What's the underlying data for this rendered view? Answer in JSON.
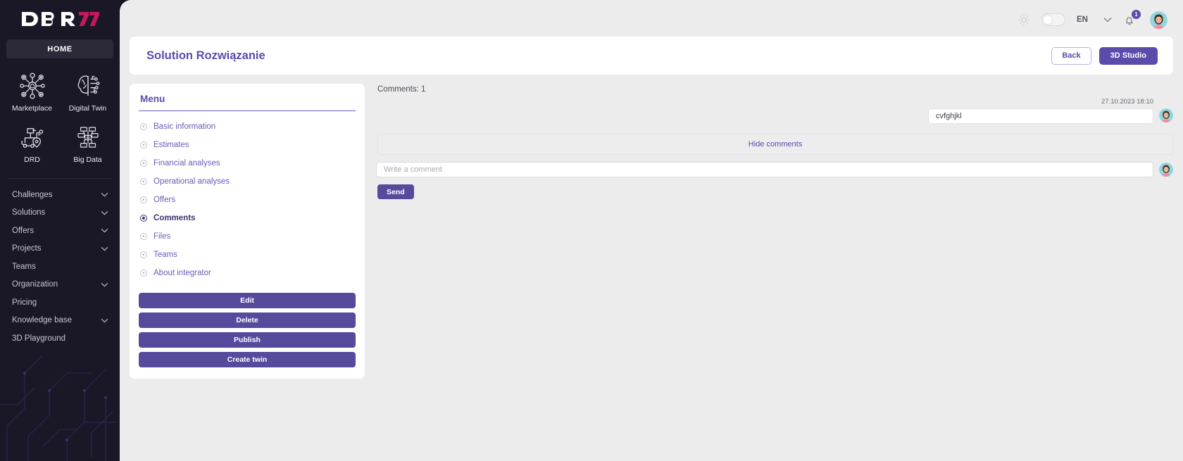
{
  "sidebar": {
    "logo_text": "DBR77",
    "home_label": "HOME",
    "quick": [
      {
        "label": "Marketplace",
        "icon": "marketplace-network-icon"
      },
      {
        "label": "Digital Twin",
        "icon": "digital-twin-brain-icon"
      },
      {
        "label": "DRD",
        "icon": "drd-map-icon"
      },
      {
        "label": "Big Data",
        "icon": "big-data-server-icon"
      }
    ],
    "nav": [
      {
        "label": "Challenges",
        "chevron": true
      },
      {
        "label": "Solutions",
        "chevron": true
      },
      {
        "label": "Offers",
        "chevron": true
      },
      {
        "label": "Projects",
        "chevron": true
      },
      {
        "label": "Teams",
        "chevron": false
      },
      {
        "label": "Organization",
        "chevron": true
      },
      {
        "label": "Pricing",
        "chevron": false
      },
      {
        "label": "Knowledge base",
        "chevron": true
      },
      {
        "label": "3D Playground",
        "chevron": false
      }
    ]
  },
  "topbar": {
    "sun_icon": "sun-icon",
    "theme_toggle": "theme-toggle",
    "language": "EN",
    "lang_chevron": "chevron-down-icon",
    "bell_icon": "bell-icon",
    "notification_count": "1",
    "avatar": "user-avatar"
  },
  "header": {
    "title": "Solution Rozwiązanie",
    "back_label": "Back",
    "studio_label": "3D Studio"
  },
  "menu": {
    "title": "Menu",
    "items": [
      {
        "label": "Basic information",
        "active": false
      },
      {
        "label": "Estimates",
        "active": false
      },
      {
        "label": "Financial analyses",
        "active": false
      },
      {
        "label": "Operational analyses",
        "active": false
      },
      {
        "label": "Offers",
        "active": false
      },
      {
        "label": "Comments",
        "active": true
      },
      {
        "label": "Files",
        "active": false
      },
      {
        "label": "Teams",
        "active": false
      },
      {
        "label": "About integrator",
        "active": false
      }
    ],
    "actions": [
      {
        "label": "Edit"
      },
      {
        "label": "Delete"
      },
      {
        "label": "Publish"
      },
      {
        "label": "Create twin"
      }
    ]
  },
  "comments": {
    "count_label": "Comments: 1",
    "items": [
      {
        "timestamp": "27.10.2023 18:10",
        "text": "cvfghjkl"
      }
    ],
    "hide_label": "Hide comments",
    "input_placeholder": "Write a comment",
    "input_value": "",
    "send_label": "Send"
  },
  "colors": {
    "accent": "#5b4bab",
    "button": "#564a9c",
    "sidebar_bg": "#1a1827",
    "main_bg": "#ececec",
    "logo_red": "#c8175c"
  }
}
